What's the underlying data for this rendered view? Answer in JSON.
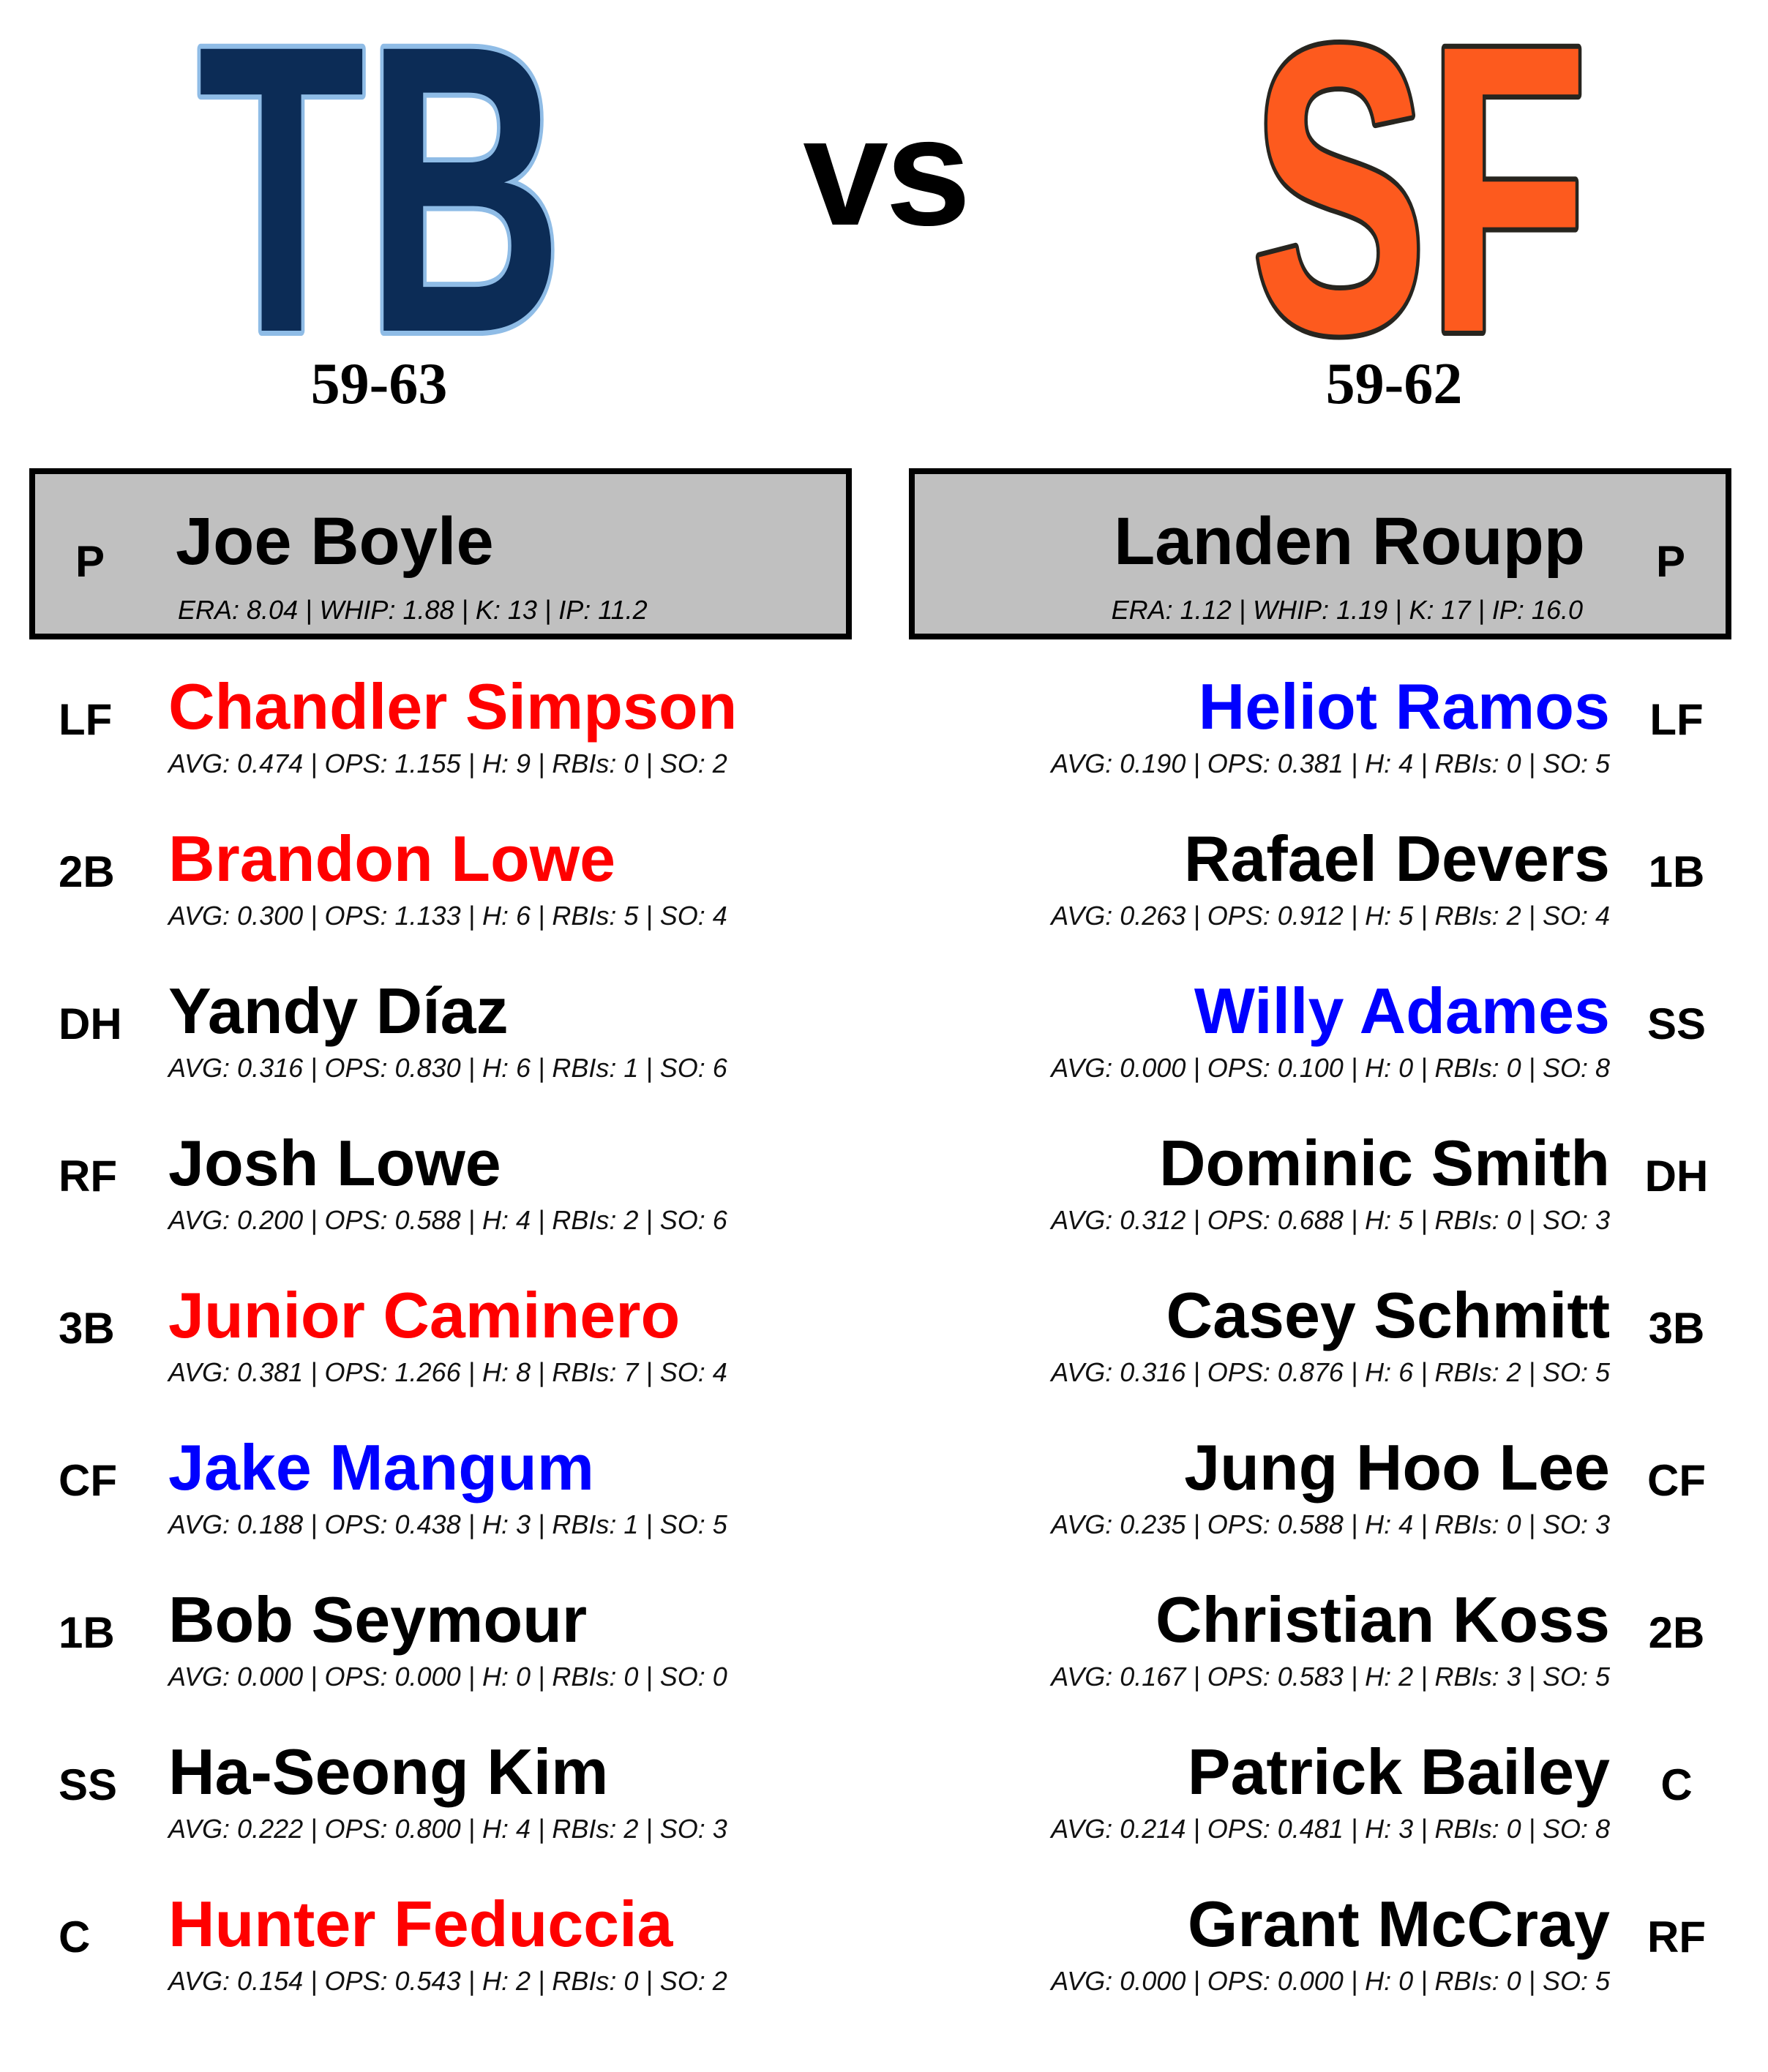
{
  "header": {
    "away_team": {
      "abbr": "TB",
      "record": "59-63",
      "fill_color": "#0c2c56",
      "outline_color": "#8fbce6"
    },
    "vs_label": "vs",
    "home_team": {
      "abbr": "SF",
      "record": "59-62",
      "fill_color": "#fd5a1e",
      "outline_color": "#27251f"
    }
  },
  "colors": {
    "hot": "#ff0000",
    "cold": "#0000ff",
    "neutral": "#000000",
    "pitcher_box_bg": "#c0c0c0"
  },
  "away": {
    "pitcher": {
      "pos": "P",
      "name": "Joe Boyle",
      "stats": "ERA: 8.04 | WHIP: 1.88 | K: 13 | IP: 11.2"
    },
    "lineup": [
      {
        "pos": "LF",
        "name": "Chandler Simpson",
        "status": "hot",
        "stats": "AVG: 0.474 | OPS: 1.155 | H: 9 | RBIs: 0 | SO: 2"
      },
      {
        "pos": "2B",
        "name": "Brandon Lowe",
        "status": "hot",
        "stats": "AVG: 0.300 | OPS: 1.133 | H: 6 | RBIs: 5 | SO: 4"
      },
      {
        "pos": "DH",
        "name": "Yandy Díaz",
        "status": "neutral",
        "stats": "AVG: 0.316 | OPS: 0.830 | H: 6 | RBIs: 1 | SO: 6"
      },
      {
        "pos": "RF",
        "name": "Josh Lowe",
        "status": "neutral",
        "stats": "AVG: 0.200 | OPS: 0.588 | H: 4 | RBIs: 2 | SO: 6"
      },
      {
        "pos": "3B",
        "name": "Junior Caminero",
        "status": "hot",
        "stats": "AVG: 0.381 | OPS: 1.266 | H: 8 | RBIs: 7 | SO: 4"
      },
      {
        "pos": "CF",
        "name": "Jake Mangum",
        "status": "cold",
        "stats": "AVG: 0.188 | OPS: 0.438 | H: 3 | RBIs: 1 | SO: 5"
      },
      {
        "pos": "1B",
        "name": "Bob Seymour",
        "status": "neutral",
        "stats": "AVG: 0.000 | OPS: 0.000 | H: 0 | RBIs: 0 | SO: 0"
      },
      {
        "pos": "SS",
        "name": "Ha-Seong Kim",
        "status": "neutral",
        "stats": "AVG: 0.222 | OPS: 0.800 | H: 4 | RBIs: 2 | SO: 3"
      },
      {
        "pos": "C",
        "name": "Hunter Feduccia",
        "status": "hot",
        "stats": "AVG: 0.154 | OPS: 0.543 | H: 2 | RBIs: 0 | SO: 2"
      }
    ]
  },
  "home": {
    "pitcher": {
      "pos": "P",
      "name": "Landen Roupp",
      "stats": "ERA: 1.12 | WHIP: 1.19 | K: 17 | IP: 16.0"
    },
    "lineup": [
      {
        "pos": "LF",
        "name": "Heliot Ramos",
        "status": "cold",
        "stats": "AVG: 0.190 | OPS: 0.381 | H: 4 | RBIs: 0 | SO: 5"
      },
      {
        "pos": "1B",
        "name": "Rafael Devers",
        "status": "neutral",
        "stats": "AVG: 0.263 | OPS: 0.912 | H: 5 | RBIs: 2 | SO: 4"
      },
      {
        "pos": "SS",
        "name": "Willy Adames",
        "status": "cold",
        "stats": "AVG: 0.000 | OPS: 0.100 | H: 0 | RBIs: 0 | SO: 8"
      },
      {
        "pos": "DH",
        "name": "Dominic Smith",
        "status": "neutral",
        "stats": "AVG: 0.312 | OPS: 0.688 | H: 5 | RBIs: 0 | SO: 3"
      },
      {
        "pos": "3B",
        "name": "Casey Schmitt",
        "status": "neutral",
        "stats": "AVG: 0.316 | OPS: 0.876 | H: 6 | RBIs: 2 | SO: 5"
      },
      {
        "pos": "CF",
        "name": "Jung Hoo Lee",
        "status": "neutral",
        "stats": "AVG: 0.235 | OPS: 0.588 | H: 4 | RBIs: 0 | SO: 3"
      },
      {
        "pos": "2B",
        "name": "Christian Koss",
        "status": "neutral",
        "stats": "AVG: 0.167 | OPS: 0.583 | H: 2 | RBIs: 3 | SO: 5"
      },
      {
        "pos": "C",
        "name": "Patrick Bailey",
        "status": "neutral",
        "stats": "AVG: 0.214 | OPS: 0.481 | H: 3 | RBIs: 0 | SO: 8"
      },
      {
        "pos": "RF",
        "name": "Grant McCray",
        "status": "neutral",
        "stats": "AVG: 0.000 | OPS: 0.000 | H: 0 | RBIs: 0 | SO: 5"
      }
    ]
  }
}
